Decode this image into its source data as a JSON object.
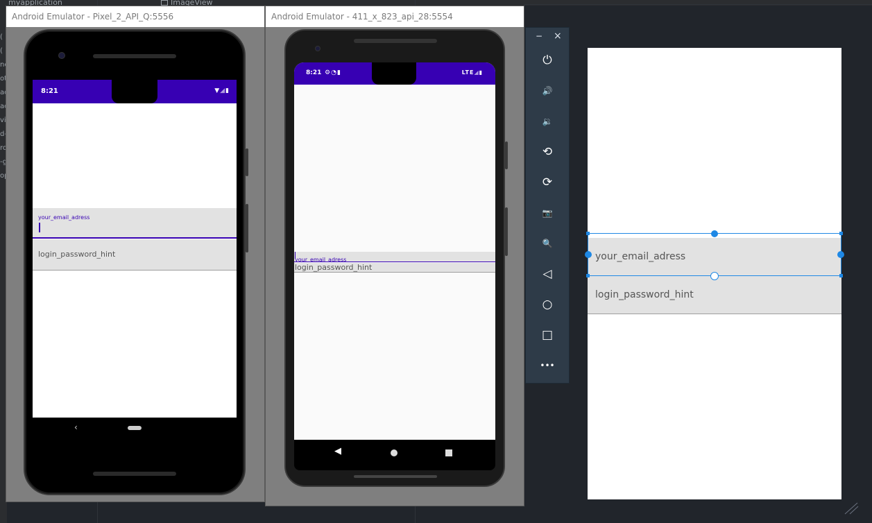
{
  "ide": {
    "project_tab": "myapplication",
    "editor_tab": "ImageView",
    "left_fragments": [
      "(",
      "(",
      "ne",
      "ot",
      "ac",
      "ac",
      "vi",
      "d-",
      "ro",
      "-g",
      "op"
    ]
  },
  "emulator_1": {
    "title": "Android Emulator - Pixel_2_API_Q:5556",
    "status_time": "8:21",
    "email_hint": "your_email_adress",
    "password_hint": "login_password_hint",
    "accent_color": "#3700b3"
  },
  "emulator_2": {
    "title": "Android Emulator - 411_x_823_api_28:5554",
    "status_time": "8:21",
    "status_network": "LTE",
    "email_hint": "your_email_adress",
    "password_hint": "login_password_hint",
    "accent_color": "#3700b3"
  },
  "toolbar": {
    "minimize": "−",
    "close": "×",
    "buttons": [
      {
        "name": "power-icon",
        "glyph": "⏻"
      },
      {
        "name": "volume-up-icon",
        "glyph": "🔊"
      },
      {
        "name": "volume-down-icon",
        "glyph": "🔉"
      },
      {
        "name": "rotate-left-icon",
        "glyph": "⟲"
      },
      {
        "name": "rotate-right-icon",
        "glyph": "⟳"
      },
      {
        "name": "camera-icon",
        "glyph": "📷"
      },
      {
        "name": "zoom-icon",
        "glyph": "🔍"
      },
      {
        "name": "back-icon",
        "glyph": "◁"
      },
      {
        "name": "home-icon",
        "glyph": "○"
      },
      {
        "name": "overview-icon",
        "glyph": "□"
      },
      {
        "name": "more-icon",
        "glyph": "•••"
      }
    ]
  },
  "preview": {
    "email_hint": "your_email_adress",
    "password_hint": "login_password_hint",
    "selection_color": "#1e88e5"
  }
}
